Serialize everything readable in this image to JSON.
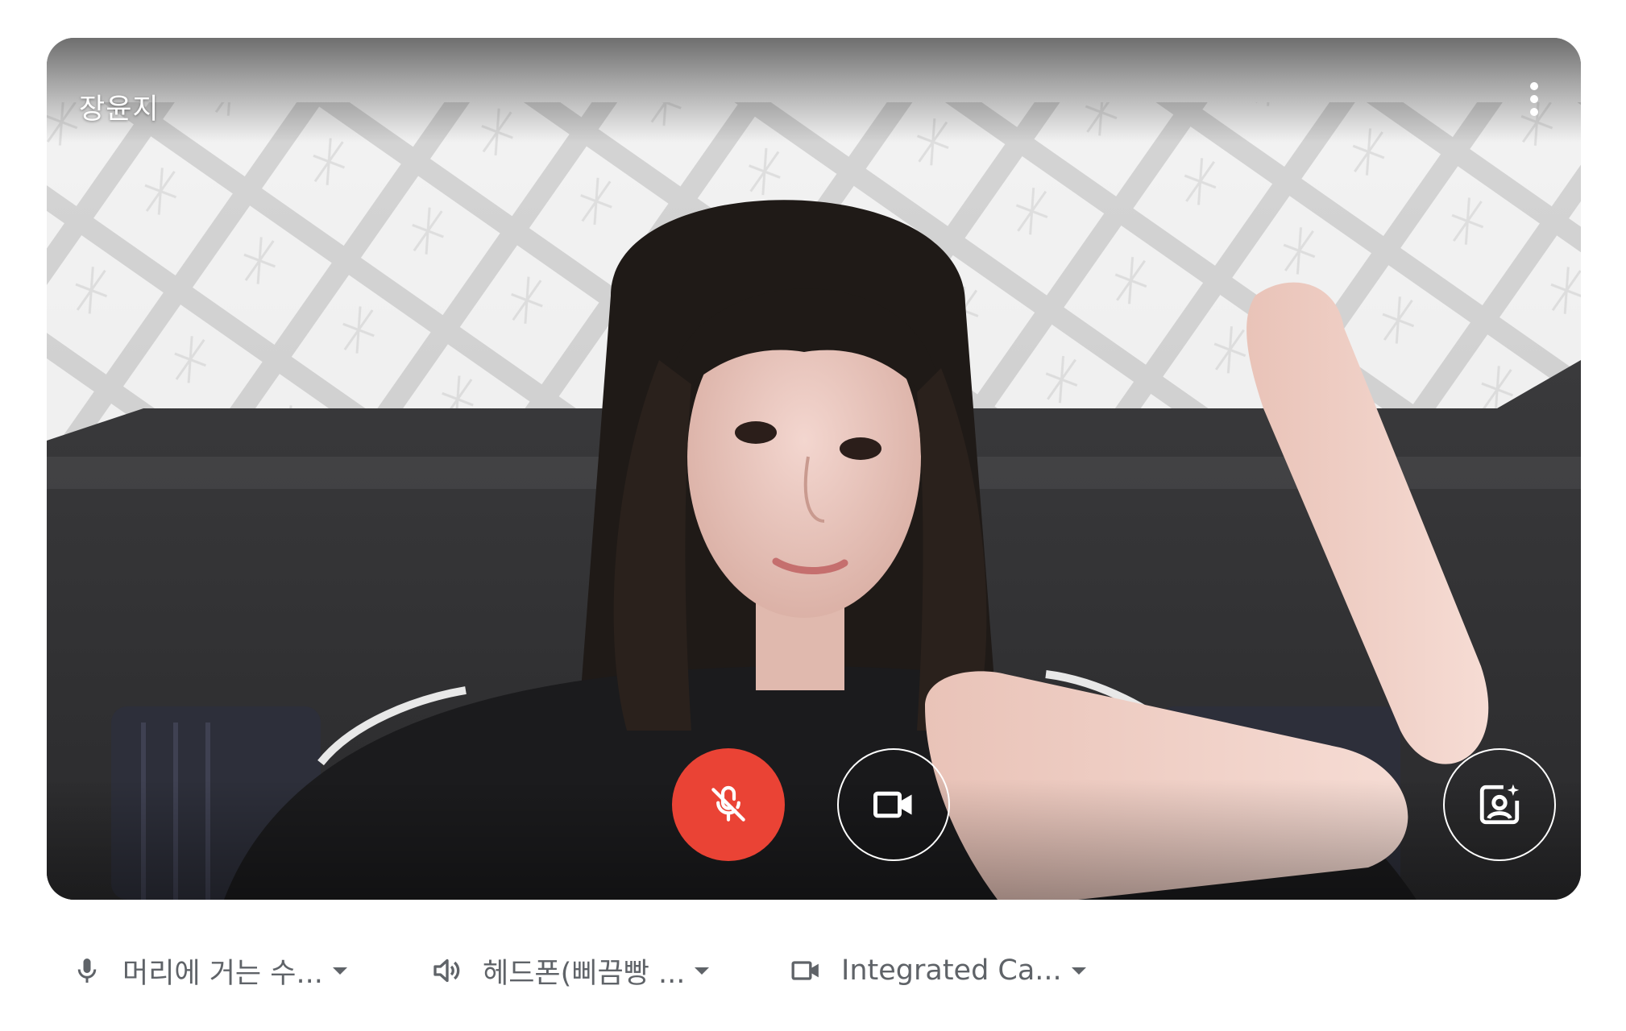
{
  "preview": {
    "participant_name": "장윤지",
    "more_icon": "more-vertical-icon",
    "controls": {
      "mic": {
        "icon": "mic-off-icon",
        "state": "muted",
        "color": "#ea4335"
      },
      "camera": {
        "icon": "videocam-icon",
        "state": "on"
      },
      "effects": {
        "icon": "visual-effects-icon"
      }
    }
  },
  "devices": {
    "microphone": {
      "icon": "mic-icon",
      "label": "머리에 거는 수..."
    },
    "speaker": {
      "icon": "volume-icon",
      "label": "헤드폰(삐끔빵 ..."
    },
    "camera": {
      "icon": "videocam-outline-icon",
      "label": "Integrated Ca..."
    }
  },
  "colors": {
    "accent_red": "#ea4335",
    "device_text": "#5f6368"
  }
}
